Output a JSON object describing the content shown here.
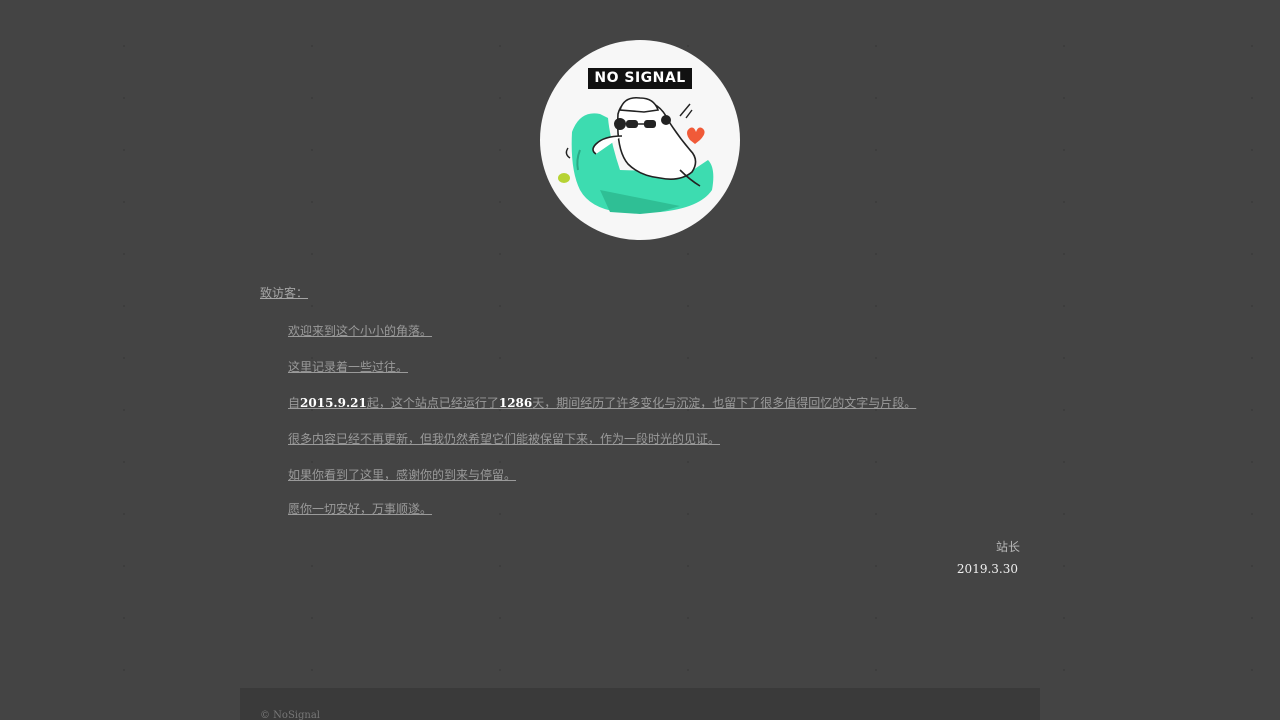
{
  "avatar": {
    "badge_text": "NO SIGNAL",
    "colors": {
      "circle": "#f7f7f7",
      "sofa": "#3ddcb0",
      "heart": "#f05a38",
      "leaf": "#b7d334"
    }
  },
  "letter": {
    "heading": "致访客：",
    "paragraphs": [
      {
        "text": "欢迎来到这个小小的角落。"
      },
      {
        "text": "这里记录着一些过往。"
      },
      {
        "pre": "自",
        "date": "2015.9.21",
        "mid": "起，这个站点已经运行了",
        "days": "1286",
        "post": "天，期间经历了许多变化与沉淀，也留下了很多值得回忆的文字与片段。"
      },
      {
        "text": "很多内容已经不再更新，但我仍然希望它们能被保留下来，作为一段时光的见证。"
      },
      {
        "text": "如果你看到了这里，感谢你的到来与停留。"
      },
      {
        "text": "愿你一切安好，万事顺遂。"
      }
    ],
    "signature": "站长",
    "date": "2019.3.30"
  },
  "footer": {
    "text": "© NoSignal"
  }
}
